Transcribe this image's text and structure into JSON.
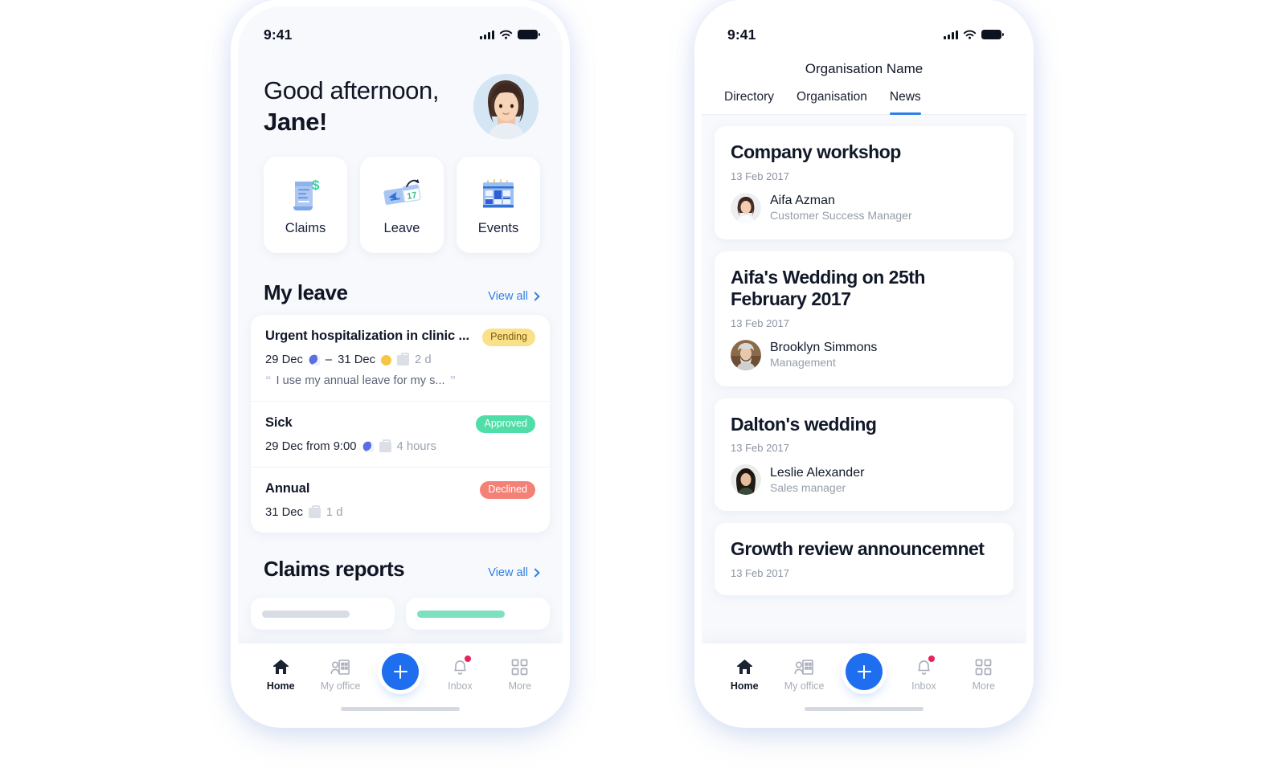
{
  "status_bar": {
    "time": "9:41",
    "signal_icon": "cellular-bars-icon",
    "wifi_icon": "wifi-icon",
    "battery_icon": "battery-full-icon"
  },
  "colors": {
    "accent_blue": "#1f6ef0",
    "link_blue": "#2f7fe4",
    "pending_bg": "#fbe08a",
    "approved_bg": "#4fdda8",
    "declined_bg": "#f48177",
    "badge_dot_red": "#e8225c",
    "screen_bg": "#f7f9fc"
  },
  "left_phone": {
    "greeting_line1": "Good afternoon,",
    "greeting_line2": "Jane!",
    "avatar_name": "profile-avatar",
    "quick_actions": [
      {
        "label": "Claims",
        "icon": "receipt-dollar-icon"
      },
      {
        "label": "Leave",
        "icon": "plane-ticket-calendar-icon"
      },
      {
        "label": "Events",
        "icon": "calendar-grid-icon"
      }
    ],
    "my_leave": {
      "title": "My leave",
      "view_all": "View all",
      "rows": [
        {
          "title": "Urgent hospitalization in clinic ...",
          "status": "Pending",
          "status_kind": "pending",
          "start": "29 Dec",
          "start_icon": "moon-icon",
          "dash": "–",
          "end": "31 Dec",
          "end_icon": "sun-icon",
          "duration_icon": "briefcase-icon",
          "duration": "2 d",
          "quote": "I use my annual leave for my s...",
          "quote_open": "“",
          "quote_close": "”"
        },
        {
          "title": "Sick",
          "status": "Approved",
          "status_kind": "approved",
          "start": "29 Dec from 9:00",
          "start_icon": "moon-icon",
          "duration_icon": "briefcase-icon",
          "duration": "4 hours"
        },
        {
          "title": "Annual",
          "status": "Declined",
          "status_kind": "declined",
          "start": "31 Dec",
          "duration_icon": "briefcase-icon",
          "duration": "1 d"
        }
      ]
    },
    "claims_reports": {
      "title": "Claims reports",
      "view_all": "View all"
    },
    "tabbar": [
      {
        "label": "Home",
        "icon": "home-icon",
        "active": true,
        "badge": false
      },
      {
        "label": "My office",
        "icon": "office-icon",
        "active": false,
        "badge": false
      },
      {
        "label": "Inbox",
        "icon": "bell-icon",
        "active": false,
        "badge": true
      },
      {
        "label": "More",
        "icon": "grid-icon",
        "active": false,
        "badge": false
      }
    ],
    "fab": {
      "icon": "plus-icon",
      "label": ""
    }
  },
  "right_phone": {
    "org_title": "Organisation Name",
    "tabs": [
      {
        "label": "Directory",
        "active": false
      },
      {
        "label": "Organisation",
        "active": false
      },
      {
        "label": "News",
        "active": true
      }
    ],
    "news": [
      {
        "title": "Company workshop",
        "date": "13 Feb 2017",
        "author_name": "Aifa Azman",
        "author_role": "Customer Success Manager",
        "avatar": "avatar-aifa"
      },
      {
        "title": "Aifa's Wedding on 25th February 2017",
        "date": "13 Feb 2017",
        "author_name": "Brooklyn Simmons",
        "author_role": "Management",
        "avatar": "avatar-brooklyn"
      },
      {
        "title": "Dalton's wedding",
        "date": "13 Feb 2017",
        "author_name": "Leslie Alexander",
        "author_role": "Sales manager",
        "avatar": "avatar-leslie"
      },
      {
        "title": "Growth review announcemnet",
        "date": "13 Feb 2017",
        "author_name": "",
        "author_role": "",
        "avatar": ""
      }
    ],
    "tabbar": [
      {
        "label": "Home",
        "icon": "home-icon",
        "active": true,
        "badge": false
      },
      {
        "label": "My office",
        "icon": "office-icon",
        "active": false,
        "badge": false
      },
      {
        "label": "Inbox",
        "icon": "bell-icon",
        "active": false,
        "badge": true
      },
      {
        "label": "More",
        "icon": "grid-icon",
        "active": false,
        "badge": false
      }
    ],
    "fab": {
      "icon": "plus-icon",
      "label": ""
    }
  }
}
